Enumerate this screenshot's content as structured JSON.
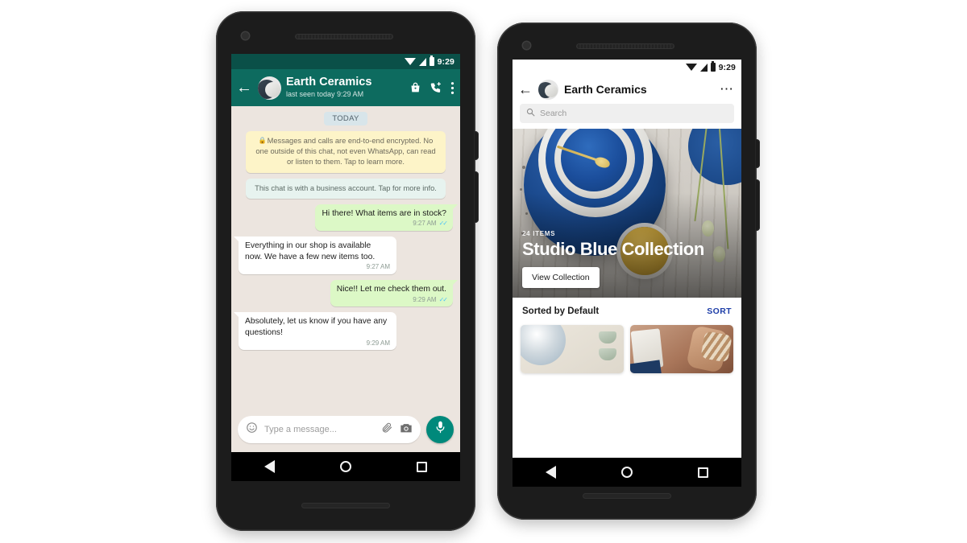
{
  "phone1": {
    "status": {
      "time": "9:29",
      "icons": [
        "wifi-icon",
        "signal-icon",
        "battery-icon"
      ]
    },
    "header": {
      "back_icon": "back-arrow-icon",
      "contact_name": "Earth Ceramics",
      "presence": "last seen today 9:29 AM",
      "catalog_icon": "shopping-bag-icon",
      "call_icon": "phone-add-icon",
      "overflow_icon": "more-vertical-icon"
    },
    "chat": {
      "day_divider": "TODAY",
      "encryption_notice": "Messages and calls are end-to-end encrypted. No one outside of this chat, not even WhatsApp, can read or listen to them. Tap to learn more.",
      "business_notice": "This chat is with a business account. Tap for more info.",
      "messages": [
        {
          "direction": "out",
          "text": "Hi there! What items are in stock?",
          "time": "9:27 AM",
          "status": "read"
        },
        {
          "direction": "in",
          "text": "Everything in our shop is available now. We have a few new items too.",
          "time": "9:27 AM",
          "status": ""
        },
        {
          "direction": "out",
          "text": "Nice!! Let me check them out.",
          "time": "9:29 AM",
          "status": "read"
        },
        {
          "direction": "in",
          "text": "Absolutely, let us know if you have any questions!",
          "time": "9:29 AM",
          "status": ""
        }
      ]
    },
    "compose": {
      "emoji_icon": "emoji-smiley-icon",
      "placeholder": "Type a message...",
      "attach_icon": "paperclip-icon",
      "camera_icon": "camera-icon",
      "mic_icon": "microphone-icon"
    },
    "navbar": {
      "back": "nav-back-triangle",
      "home": "nav-home-circle",
      "recents": "nav-recents-square"
    }
  },
  "phone2": {
    "status": {
      "time": "9:29",
      "icons": [
        "wifi-icon",
        "signal-icon",
        "battery-icon"
      ]
    },
    "header": {
      "back_icon": "back-arrow-icon",
      "title": "Earth Ceramics",
      "overflow_icon": "more-horizontal-icon"
    },
    "search": {
      "icon": "search-icon",
      "placeholder": "Search",
      "value": ""
    },
    "hero": {
      "item_count": "24 ITEMS",
      "collection_title": "Studio Blue Collection",
      "cta_label": "View Collection"
    },
    "sort": {
      "label": "Sorted by Default",
      "action": "SORT"
    },
    "products": [
      {
        "name": "product-card-speckled-bowl-set"
      },
      {
        "name": "product-card-artisan-at-work"
      }
    ],
    "navbar": {
      "back": "nav-back-triangle",
      "home": "nav-home-circle",
      "recents": "nav-recents-square"
    }
  },
  "colors": {
    "whatsapp_teal": "#0d6b5f",
    "whatsapp_statusbar": "#0a5048",
    "outgoing_bubble": "#dcf8c6",
    "incoming_bubble": "#ffffff",
    "chat_background": "#ece5df",
    "encryption_notice": "#fdf4c8",
    "business_notice": "#e7f3ef",
    "mic_button": "#00897b",
    "sort_link": "#1e3ea8",
    "read_ticks": "#4fc3f7"
  }
}
